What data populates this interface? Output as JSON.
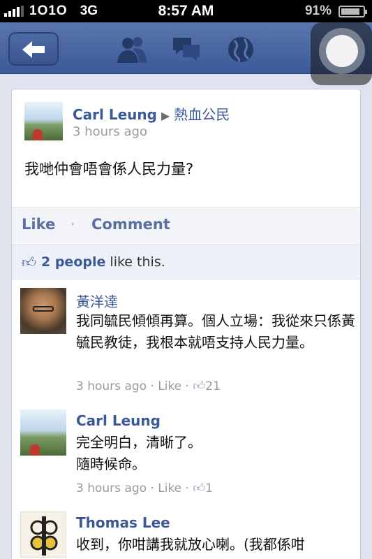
{
  "status": {
    "carrier": "1O1O",
    "network": "3G",
    "time": "8:57 AM",
    "battery": "91%"
  },
  "nav": {
    "back_icon": "arrow-left-icon",
    "icons": [
      "friends-icon",
      "messages-icon",
      "globe-icon"
    ]
  },
  "post": {
    "author": "Carl Leung",
    "group": "熱血公民",
    "time": "3 hours ago",
    "text": "我哋仲會唔會係人民力量?",
    "actions": {
      "like": "Like",
      "separator": "·",
      "comment": "Comment"
    },
    "likes": {
      "count": "2 people",
      "suffix": "like this."
    }
  },
  "comments": [
    {
      "author": "黃洋達",
      "text": "我同毓民傾傾再算。個人立場：我從來只係黃毓民教徒，我根本就唔支持人民力量。",
      "time": "3 hours ago",
      "like": "Like",
      "likes": "21"
    },
    {
      "author": "Carl Leung",
      "text_line1": "完全明白，清晰了。",
      "text_line2": "隨時候命。",
      "time": "3 hours ago",
      "like": "Like",
      "likes": "1"
    },
    {
      "author": "Thomas Lee",
      "text": "收到，你咁講我就放心喇。(我都係咁"
    }
  ],
  "colors": {
    "brand": "#3b5998",
    "navbar": "#4a65a0"
  }
}
